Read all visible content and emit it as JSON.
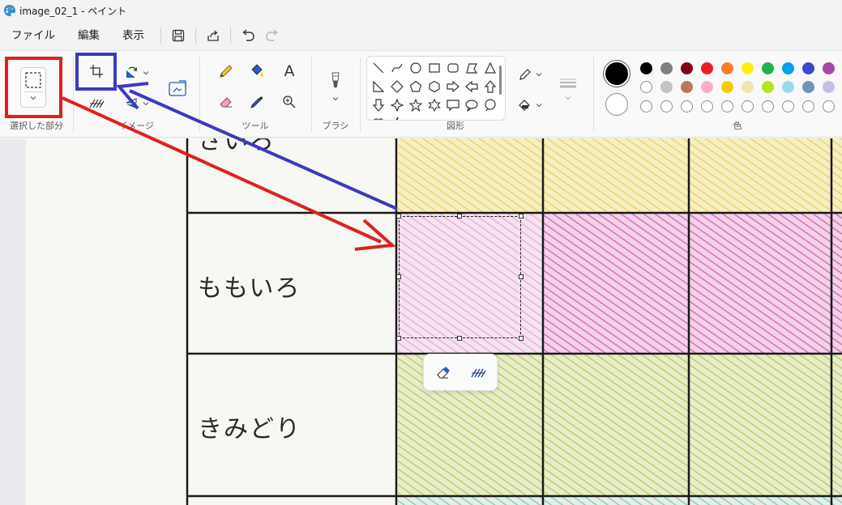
{
  "window": {
    "title": "image_02_1 - ペイント"
  },
  "menu": {
    "file": "ファイル",
    "edit": "編集",
    "view": "表示"
  },
  "ribbon": {
    "selection_label": "選択した部分",
    "image_label": "イメージ",
    "tools_label": "ツール",
    "brush_label": "ブラシ",
    "shapes_label": "図形",
    "colors_label": "色",
    "text_tool_glyph": "A"
  },
  "colors": {
    "primary": "#000000",
    "secondary": "#ffffff",
    "palette_row1": [
      "#000000",
      "#7f7f7f",
      "#880015",
      "#ed1c24",
      "#ff7f27",
      "#fff200",
      "#22b14c",
      "#00a2e8",
      "#3f48cc",
      "#a349a4"
    ],
    "palette_row2": [
      "#ffffff",
      "#c3c3c3",
      "#b97a57",
      "#ffaec9",
      "#ffc90e",
      "#efe4b0",
      "#b5e61d",
      "#99d9ea",
      "#7092be",
      "#c8bfe7"
    ],
    "palette_row3_count": 10
  },
  "canvas": {
    "rows": [
      {
        "label": "さいろ",
        "color": "yellow"
      },
      {
        "label": "ももいろ",
        "color": "pink"
      },
      {
        "label": "きみどり",
        "color": "yellowgreen"
      }
    ]
  },
  "annotations": {
    "red_color": "#e02020",
    "blue_color": "#3a3ac0"
  },
  "icons": {
    "app": "paint-palette-icon",
    "save": "save-icon",
    "share": "share-icon",
    "undo": "undo-icon",
    "redo": "redo-icon",
    "crop": "crop-icon",
    "rotate": "rotate-icon",
    "flip": "flip-icon",
    "resize": "resize-icon",
    "remove_background": "remove-background-icon",
    "pencil": "pencil-icon",
    "fill": "fill-bucket-icon",
    "text": "text-icon",
    "eraser": "eraser-icon",
    "color_picker": "color-picker-icon",
    "magnifier": "magnifier-icon",
    "brush": "brush-icon",
    "outline": "shape-outline-icon",
    "shape_fill": "shape-fill-icon",
    "size": "size-icon"
  }
}
